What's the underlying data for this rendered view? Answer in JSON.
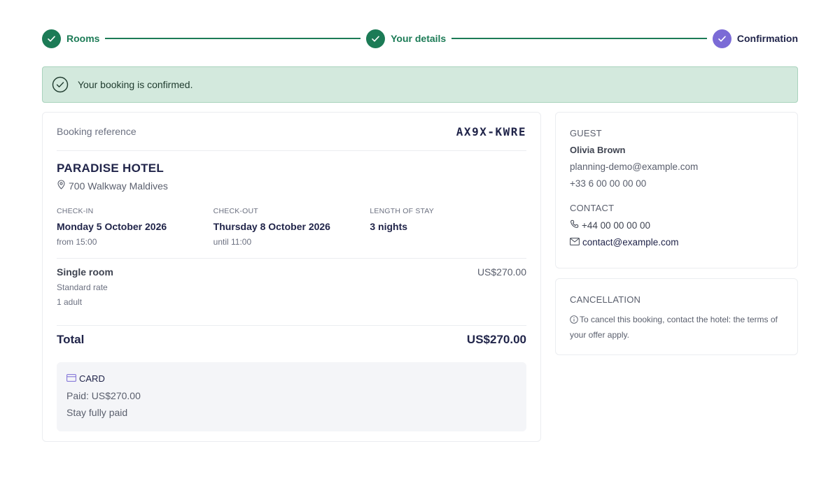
{
  "stepper": {
    "steps": [
      {
        "label": "Rooms",
        "state": "done"
      },
      {
        "label": "Your details",
        "state": "done"
      },
      {
        "label": "Confirmation",
        "state": "current"
      }
    ]
  },
  "alert": {
    "text": "Your booking is confirmed.",
    "icon": "check-circle-icon"
  },
  "booking": {
    "reference_label": "Booking reference",
    "reference": "AX9X-KWRE",
    "hotel_name": "PARADISE HOTEL",
    "address": "700 Walkway Maldives",
    "checkin": {
      "label": "CHECK-IN",
      "date": "Monday 5 October 2026",
      "time": "from 15:00"
    },
    "checkout": {
      "label": "CHECK-OUT",
      "date": "Thursday 8 October 2026",
      "time": "until 11:00"
    },
    "stay": {
      "label": "LENGTH OF STAY",
      "value": "3 nights"
    },
    "room": {
      "name": "Single room",
      "rate": "Standard rate",
      "guests": "1 adult",
      "price": "US$270.00"
    },
    "total": {
      "label": "Total",
      "value": "US$270.00"
    },
    "payment": {
      "method": "CARD",
      "paid": "Paid: US$270.00",
      "status": "Stay fully paid"
    }
  },
  "guest": {
    "title": "GUEST",
    "name": "Olivia Brown",
    "email": "planning-demo@example.com",
    "phone": "+33 6 00 00 00 00"
  },
  "contact": {
    "title": "CONTACT",
    "phone": "+44 00 00 00 00",
    "email": "contact@example.com"
  },
  "cancellation": {
    "title": "CANCELLATION",
    "text": "To cancel this booking, contact the hotel: the terms of your offer apply."
  },
  "colors": {
    "primary_green": "#1c7b56",
    "current_step": "#7b6bd6",
    "alert_bg": "#d3e9dd",
    "navy": "#21254a"
  }
}
